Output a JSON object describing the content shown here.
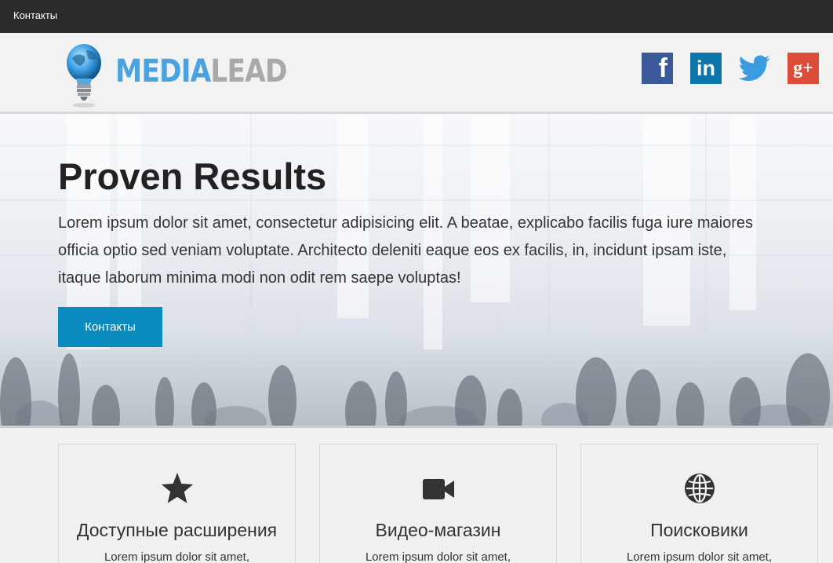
{
  "topbar": {
    "link": "Контакты"
  },
  "header": {
    "logo": {
      "part1": "MEDIA",
      "part2": "LEAD"
    },
    "social": [
      {
        "name": "facebook",
        "glyph": "f",
        "color": "#3b5998"
      },
      {
        "name": "linkedin",
        "glyph": "in",
        "color": "#0e76a8"
      },
      {
        "name": "twitter",
        "color": "#3b9be0"
      },
      {
        "name": "google-plus",
        "glyph": "g+",
        "color": "#dd4b39"
      }
    ]
  },
  "hero": {
    "title": "Proven Results",
    "text": "Lorem ipsum dolor sit amet, consectetur adipisicing elit. A beatae, explicabo facilis fuga iure maiores officia optio sed veniam voluptate. Architecto deleniti eaque eos ex facilis, in, incidunt ipsam iste, itaque laborum minima modi non odit rem saepe voluptas!",
    "button": "Контакты",
    "accent": "#0a8bc0"
  },
  "features": [
    {
      "icon": "star-icon",
      "title": "Доступные расширения",
      "text": "Lorem ipsum dolor sit amet,"
    },
    {
      "icon": "video-camera-icon",
      "title": "Видео-магазин",
      "text": "Lorem ipsum dolor sit amet,"
    },
    {
      "icon": "globe-icon",
      "title": "Поисковики",
      "text": "Lorem ipsum dolor sit amet,"
    }
  ]
}
